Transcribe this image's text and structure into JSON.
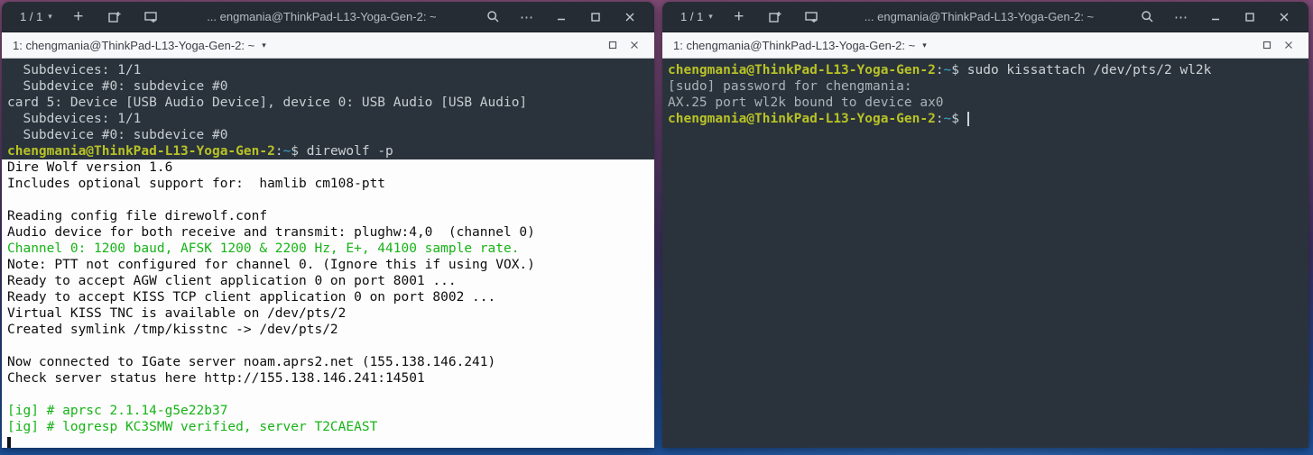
{
  "colors": {
    "wallpaper_top": "#7e4a74",
    "wallpaper_bottom": "#1b4f97",
    "headerbar_bg": "#262c34",
    "pane_titlebar_bg": "#f7f8fa",
    "terminal_bg": "#2a333b",
    "terminal_fg": "#c6ced3",
    "prompt_color": "#b8c226",
    "tilde_color": "#3ba6c9",
    "direwolf_bg": "#fdfdfd",
    "direwolf_fg": "#0e0e0e",
    "direwolf_green": "#17b317"
  },
  "icons": {
    "caret_down": "▾",
    "plus": "+",
    "menu_dots": "⋯",
    "minimize": "−",
    "maximize": "□",
    "close": "×",
    "pane_maximize": "□",
    "pane_close": "×"
  },
  "windows": [
    {
      "header": {
        "session_indicator": "1 / 1",
        "title": "... engmania@ThinkPad-L13-Yoga-Gen-2: ~"
      },
      "pane_titlebar": {
        "title": "1: chengmania@ThinkPad-L13-Yoga-Gen-2: ~"
      },
      "terminal": {
        "blocks": [
          {
            "bg": "dark",
            "fill": false,
            "lines": [
              [
                [
                  "w",
                  "  Subdevices: 1/1"
                ]
              ],
              [
                [
                  "w",
                  "  Subdevice #0: subdevice #0"
                ]
              ],
              [
                [
                  "w",
                  "card 5: Device [USB Audio Device], device 0: USB Audio [USB Audio]"
                ]
              ],
              [
                [
                  "w",
                  "  Subdevices: 1/1"
                ]
              ],
              [
                [
                  "w",
                  "  Subdevice #0: subdevice #0"
                ]
              ],
              [
                [
                  "p",
                  "chengmania@ThinkPad-L13-Yoga-Gen-2"
                ],
                [
                  "w",
                  ":"
                ],
                [
                  "t",
                  "~"
                ],
                [
                  "w",
                  "$ "
                ],
                [
                  "c",
                  "direwolf -p"
                ]
              ]
            ]
          },
          {
            "bg": "white",
            "fill": true,
            "lines": [
              [
                [
                  "k",
                  "Dire Wolf version 1.6"
                ]
              ],
              [
                [
                  "k",
                  "Includes optional support for:  hamlib cm108-ptt"
                ]
              ],
              [],
              [
                [
                  "k",
                  "Reading config file direwolf.conf"
                ]
              ],
              [
                [
                  "k",
                  "Audio device for both receive and transmit: plughw:4,0  (channel 0)"
                ]
              ],
              [
                [
                  "g",
                  "Channel 0: 1200 baud, AFSK 1200 & 2200 Hz, E+, 44100 sample rate."
                ]
              ],
              [
                [
                  "k",
                  "Note: PTT not configured for channel 0. (Ignore this if using VOX.)"
                ]
              ],
              [
                [
                  "k",
                  "Ready to accept AGW client application 0 on port 8001 ..."
                ]
              ],
              [
                [
                  "k",
                  "Ready to accept KISS TCP client application 0 on port 8002 ..."
                ]
              ],
              [
                [
                  "k",
                  "Virtual KISS TNC is available on /dev/pts/2"
                ]
              ],
              [
                [
                  "k",
                  "Created symlink /tmp/kisstnc -> /dev/pts/2"
                ]
              ],
              [],
              [
                [
                  "k",
                  "Now connected to IGate server noam.aprs2.net (155.138.146.241)"
                ]
              ],
              [
                [
                  "k",
                  "Check server status here http://155.138.146.241:14501"
                ]
              ],
              [],
              [
                [
                  "g",
                  "[ig] # aprsc 2.1.14-g5e22b37"
                ]
              ],
              [
                [
                  "g",
                  "[ig] # logresp KC3SMW verified, server T2CAEAST"
                ]
              ],
              [
                [
                  "cb",
                  ""
                ]
              ]
            ]
          }
        ]
      }
    },
    {
      "header": {
        "session_indicator": "1 / 1",
        "title": "... engmania@ThinkPad-L13-Yoga-Gen-2: ~"
      },
      "pane_titlebar": {
        "title": "1: chengmania@ThinkPad-L13-Yoga-Gen-2: ~"
      },
      "terminal": {
        "blocks": [
          {
            "bg": "dark",
            "fill": true,
            "lines": [
              [
                [
                  "p",
                  "chengmania@ThinkPad-L13-Yoga-Gen-2"
                ],
                [
                  "w",
                  ":"
                ],
                [
                  "t",
                  "~"
                ],
                [
                  "w",
                  "$ "
                ],
                [
                  "c",
                  "sudo kissattach /dev/pts/2 wl2k"
                ]
              ],
              [
                [
                  "d",
                  "[sudo] password for chengmania:"
                ]
              ],
              [
                [
                  "d",
                  "AX.25 port wl2k bound to device ax0"
                ]
              ],
              [
                [
                  "p",
                  "chengmania@ThinkPad-L13-Yoga-Gen-2"
                ],
                [
                  "w",
                  ":"
                ],
                [
                  "t",
                  "~"
                ],
                [
                  "w",
                  "$ "
                ],
                [
                  "cl",
                  ""
                ]
              ]
            ]
          }
        ]
      }
    }
  ]
}
